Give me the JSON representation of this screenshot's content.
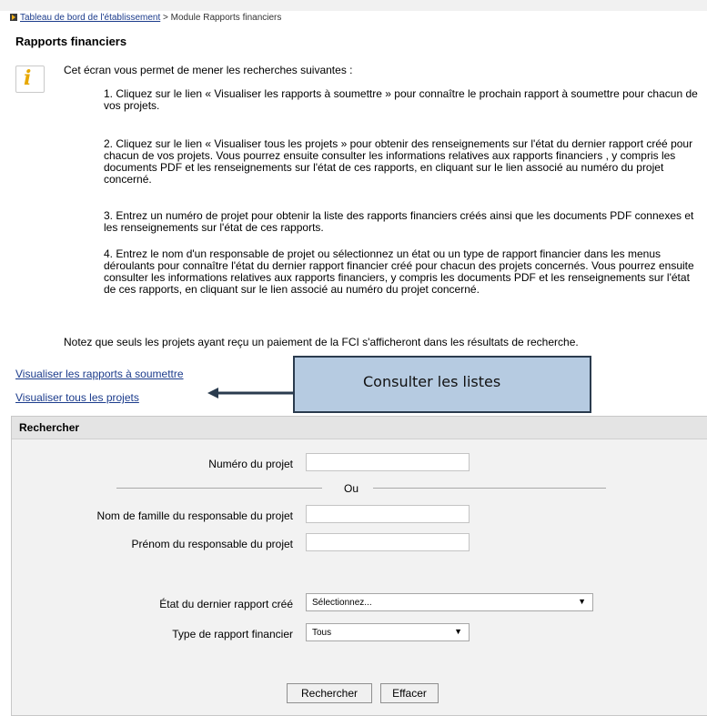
{
  "breadcrumb": {
    "link": "Tableau de bord de l'établissement",
    "separator": " > ",
    "current": "Module Rapports financiers"
  },
  "page_title": "Rapports financiers",
  "info": {
    "icon": "info-icon",
    "intro": "Cet écran vous permet de mener les recherches suivantes :",
    "steps": [
      "1. Cliquez sur le lien « Visualiser les rapports à soumettre » pour connaître le prochain rapport à soumettre pour chacun de vos projets.",
      "2. Cliquez sur le lien « Visualiser tous les projets » pour obtenir des renseignements sur l'état du dernier rapport créé pour chacun de vos projets. Vous pourrez ensuite consulter les informations relatives aux rapports financiers , y compris les documents PDF et les renseignements sur l'état de ces rapports, en cliquant sur le lien associé au numéro du projet concerné.",
      "3. Entrez un numéro de projet pour obtenir la liste des rapports financiers créés ainsi que les documents PDF connexes et les renseignements sur l'état de ces rapports.",
      "4. Entrez le nom d'un responsable de projet ou sélectionnez un état ou un type de rapport financier dans les menus déroulants pour connaître l'état du dernier rapport financier créé pour chacun des projets concernés. Vous pourrez ensuite consulter les informations relatives aux rapports financiers, y compris les documents PDF et les renseignements sur l'état de ces rapports, en cliquant sur le lien associé au numéro du projet concerné."
    ],
    "note": "Notez que seuls les projets ayant reçu un paiement de la FCI s'afficheront dans les résultats de recherche."
  },
  "links": {
    "reports_to_submit": "Visualiser les rapports à soumettre",
    "all_projects": "Visualiser tous les projets"
  },
  "callout": "Consulter les listes",
  "search": {
    "title": "Rechercher",
    "project_number_label": "Numéro du projet",
    "project_number_value": "",
    "or_label": "Ou",
    "last_name_label": "Nom de famille du responsable du projet",
    "last_name_value": "",
    "first_name_label": "Prénom du responsable du projet",
    "first_name_value": "",
    "state_label": "État du dernier rapport créé",
    "state_value": "Sélectionnez...",
    "type_label": "Type de rapport financier",
    "type_value": "Tous",
    "search_button": "Rechercher",
    "clear_button": "Effacer"
  },
  "colors": {
    "link": "#1c3c8c",
    "callout_bg": "#b6cbe1",
    "callout_border": "#2a3b4e",
    "info_icon": "#e7a800",
    "panel_bg": "#f2f2f2"
  }
}
